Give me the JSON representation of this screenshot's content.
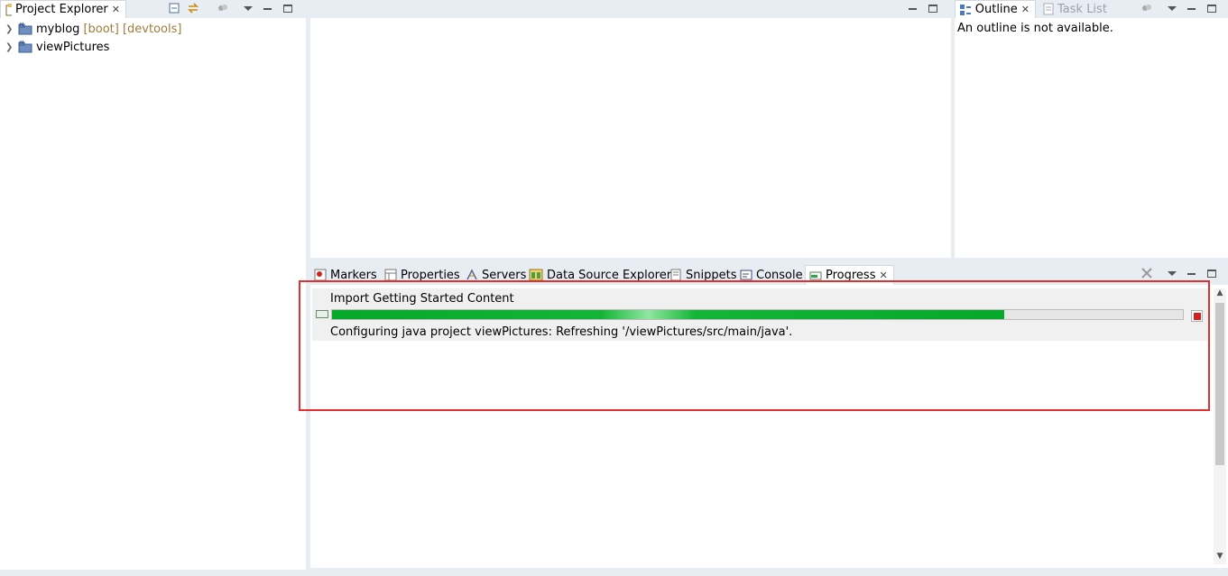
{
  "project_explorer": {
    "tab_label": "Project Explorer",
    "close_glyph": "✕",
    "tree": [
      {
        "name": "myblog",
        "decoration": "[boot] [devtools]",
        "icon": "java-project-icon"
      },
      {
        "name": "viewPictures",
        "decoration": "",
        "icon": "java-project-icon"
      }
    ]
  },
  "outline": {
    "tabs": [
      {
        "label": "Outline",
        "active": true
      },
      {
        "label": "Task List",
        "active": false
      }
    ],
    "close_glyph": "✕",
    "message": "An outline is not available."
  },
  "bottom_panel": {
    "tabs": [
      {
        "label": "Markers",
        "icon": "markers-icon",
        "active": false
      },
      {
        "label": "Properties",
        "icon": "properties-icon",
        "active": false
      },
      {
        "label": "Servers",
        "icon": "servers-icon",
        "active": false
      },
      {
        "label": "Data Source Explorer",
        "icon": "data-source-icon",
        "active": false
      },
      {
        "label": "Snippets",
        "icon": "snippets-icon",
        "active": false
      },
      {
        "label": "Console",
        "icon": "console-icon",
        "active": false
      },
      {
        "label": "Progress",
        "icon": "progress-icon",
        "active": true
      }
    ],
    "close_glyph": "✕"
  },
  "progress": {
    "job_title": "Import Getting Started Content",
    "fraction": 0.79,
    "status": "Configuring java project viewPictures: Refreshing '/viewPictures/src/main/java'.",
    "bar_color": "#06a82a"
  },
  "colors": {
    "highlight_border": "#e03030",
    "chrome_bg": "#e8edf4",
    "stop_red": "#d42020"
  }
}
